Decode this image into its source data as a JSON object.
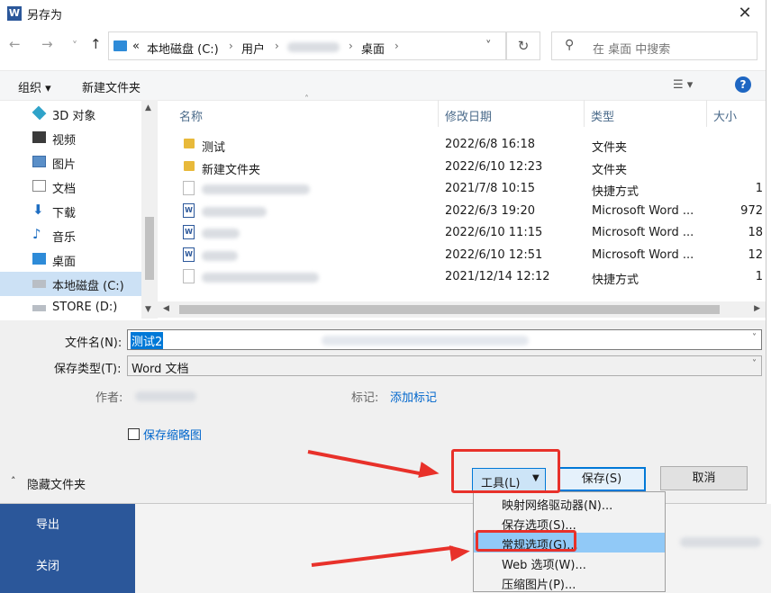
{
  "background_app": {
    "nav": [
      "导出",
      "关闭"
    ]
  },
  "dialog": {
    "title": "另存为",
    "close": "✕",
    "nav_buttons": {
      "back": "←",
      "forward": "→",
      "down": "˅",
      "up": "↑"
    },
    "address": {
      "overflow": "«",
      "segments": [
        "本地磁盘 (C:)",
        "用户",
        "桌面"
      ],
      "sep": "›",
      "dropdown": "˅"
    },
    "refresh": "↻",
    "search": {
      "placeholder": "在 桌面 中搜索"
    },
    "toolbar": {
      "organize": "组织 ▾",
      "new_folder": "新建文件夹",
      "view": "☰ ▾",
      "help": "?"
    },
    "nav_pane": [
      {
        "label": "3D 对象",
        "icon": "cube-icon"
      },
      {
        "label": "视频",
        "icon": "video-icon"
      },
      {
        "label": "图片",
        "icon": "pictures-icon"
      },
      {
        "label": "文档",
        "icon": "documents-icon"
      },
      {
        "label": "下载",
        "icon": "download-icon"
      },
      {
        "label": "音乐",
        "icon": "music-icon"
      },
      {
        "label": "桌面",
        "icon": "desktop-icon"
      },
      {
        "label": "本地磁盘 (C:)",
        "icon": "drive-icon",
        "selected": true
      },
      {
        "label": "STORE (D:)",
        "icon": "drive-icon"
      }
    ],
    "columns": {
      "name": "名称",
      "modified": "修改日期",
      "type": "类型",
      "size": "大小"
    },
    "files": [
      {
        "name": "测试",
        "date": "2022/6/8 16:18",
        "type": "文件夹",
        "size": "",
        "icon": "folder-icon"
      },
      {
        "name": "新建文件夹",
        "date": "2022/6/10 12:23",
        "type": "文件夹",
        "size": "",
        "icon": "folder-icon"
      },
      {
        "name": "",
        "date": "2021/7/8 10:15",
        "type": "快捷方式",
        "size": "1",
        "icon": "shortcut-icon"
      },
      {
        "name": "",
        "date": "2022/6/3 19:20",
        "type": "Microsoft Word ...",
        "size": "972",
        "icon": "word-doc-icon"
      },
      {
        "name": "",
        "date": "2022/6/10 11:15",
        "type": "Microsoft Word ...",
        "size": "18",
        "icon": "word-doc-icon"
      },
      {
        "name": "",
        "date": "2022/6/10 12:51",
        "type": "Microsoft Word ...",
        "size": "12",
        "icon": "word-doc-icon"
      },
      {
        "name": "",
        "date": "2021/12/14 12:12",
        "type": "快捷方式",
        "size": "1",
        "icon": "shortcut-icon"
      }
    ],
    "form": {
      "filename_label": "文件名(N):",
      "filename_value": "测试2",
      "filetype_label": "保存类型(T):",
      "filetype_value": "Word 文档",
      "author_label": "作者:",
      "tags_label": "标记:",
      "tags_link": "添加标记",
      "thumbnail_label": "保存缩略图"
    },
    "footer": {
      "hide_folders": "隐藏文件夹",
      "tools": "工具(L)",
      "save": "保存(S)",
      "cancel": "取消"
    },
    "tools_menu": [
      "映射网络驱动器(N)...",
      "保存选项(S)...",
      "常规选项(G)...",
      "Web 选项(W)...",
      "压缩图片(P)..."
    ],
    "highlight_color": "#e8312a",
    "accent_color": "#0078d7"
  }
}
